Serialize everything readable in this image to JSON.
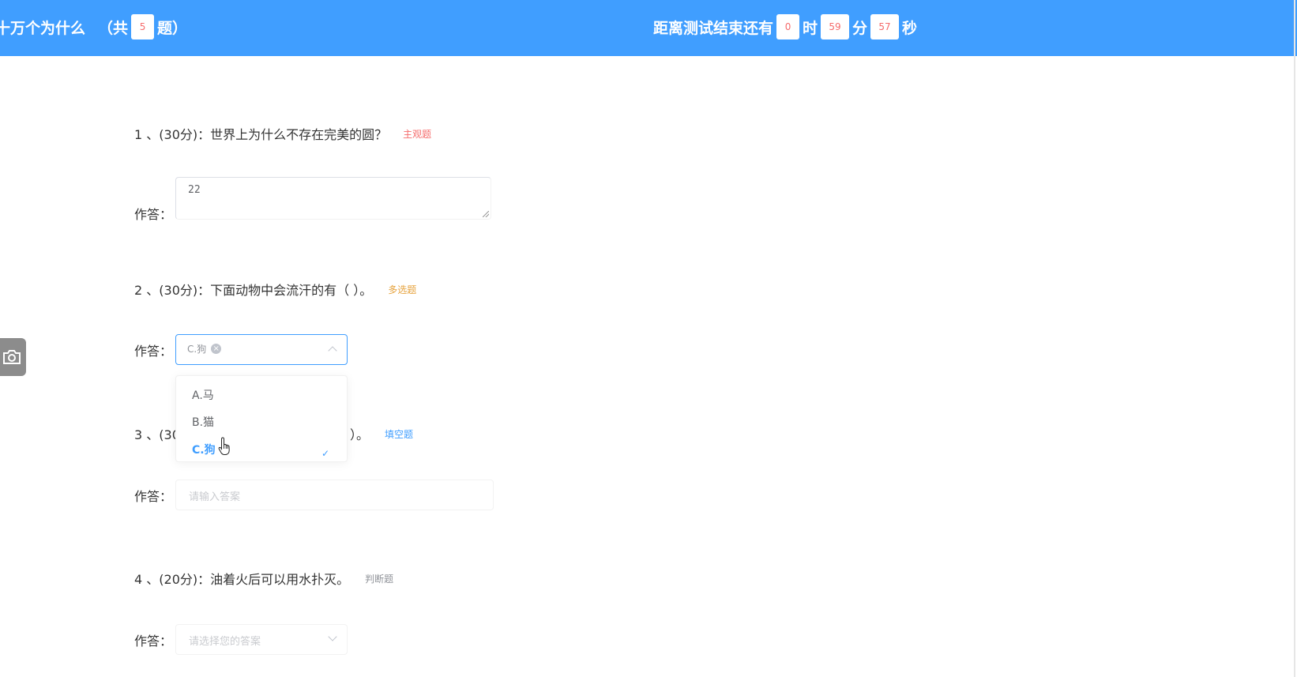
{
  "header": {
    "title": "十万个为什么",
    "count_prefix": "（共",
    "count": "5",
    "count_suffix": "题）",
    "timer_prefix": "距离测试结束还有",
    "hours": "0",
    "hours_unit": "时",
    "minutes": "59",
    "minutes_unit": "分",
    "seconds": "57",
    "seconds_unit": "秒"
  },
  "answer_label": "作答：",
  "questions": [
    {
      "text": "1 、(30分)：世界上为什么不存在完美的圆？",
      "type": "主观题",
      "answer": "22"
    },
    {
      "text": "2 、(30分)：下面动物中会流汗的有（ ）。",
      "type": "多选题",
      "selected_chip": "C.狗",
      "options": [
        "A.马",
        "B.猫",
        "C.狗"
      ]
    },
    {
      "text_start": "3 、(30",
      "text_end": "）。",
      "type": "填空题",
      "placeholder": "请输入答案"
    },
    {
      "text": "4 、(20分)：油着火后可以用水扑灭。",
      "type": "判断题",
      "placeholder": "请选择您的答案"
    }
  ],
  "icons": {
    "camera": "camera-icon",
    "check": "check-icon",
    "cursor": "hand-cursor-icon"
  },
  "colors": {
    "primary": "#409eff",
    "red": "#f56c6c",
    "orange": "#e6a23c",
    "gray": "#909399"
  }
}
